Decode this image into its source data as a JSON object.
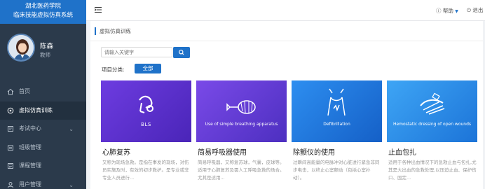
{
  "brand": {
    "line1": "湖北医药学院",
    "line2": "临床技能虚拟仿真系统"
  },
  "user": {
    "name": "陈森",
    "role": "教师"
  },
  "menu": [
    {
      "label": "首页",
      "icon": "home-icon",
      "chevron": false
    },
    {
      "label": "虚拟仿真训练",
      "icon": "simulation-icon",
      "chevron": false,
      "active": true
    },
    {
      "label": "考试中心",
      "icon": "exam-icon",
      "chevron": true
    },
    {
      "label": "班级管理",
      "icon": "class-icon",
      "chevron": false
    },
    {
      "label": "课程管理",
      "icon": "course-icon",
      "chevron": false
    },
    {
      "label": "用户管理",
      "icon": "users-icon",
      "chevron": true
    }
  ],
  "header": {
    "help_label": "帮助",
    "logout_label": "退出"
  },
  "panel": {
    "title": "虚拟仿真训练"
  },
  "search": {
    "placeholder": "请输入关键字"
  },
  "category": {
    "label": "项目分类:",
    "selected": "全部"
  },
  "cards": [
    {
      "caption": "BLS",
      "title": "心肺复苏",
      "desc": "又称为现场急救。是指在事发的现场，对伤员实施及时，有效的初步救护。是专业或非专业人员进行..."
    },
    {
      "caption": "Use of simple breathing apparatus",
      "title": "简易呼吸器使用",
      "desc": "简易呼吸器，又称复苏球，气囊，皮球等。适用于心肺复苏及需人工呼吸急救的场合。尤其是适用..."
    },
    {
      "caption": "Defibrillation",
      "title": "除颤仪的使用",
      "desc": "过瞬间高能量的电脉冲对心脏进行紧急非同步电击，以终止心室颤动（包括心室扑动）。"
    },
    {
      "caption": "Hemostatic dressing of open wounds",
      "title": "止血包扎",
      "desc": "适用于各种出血情况下的急救止血与包扎,尤其是大出血的急救处理,以压迫止血、保护伤口、固定..."
    }
  ]
}
